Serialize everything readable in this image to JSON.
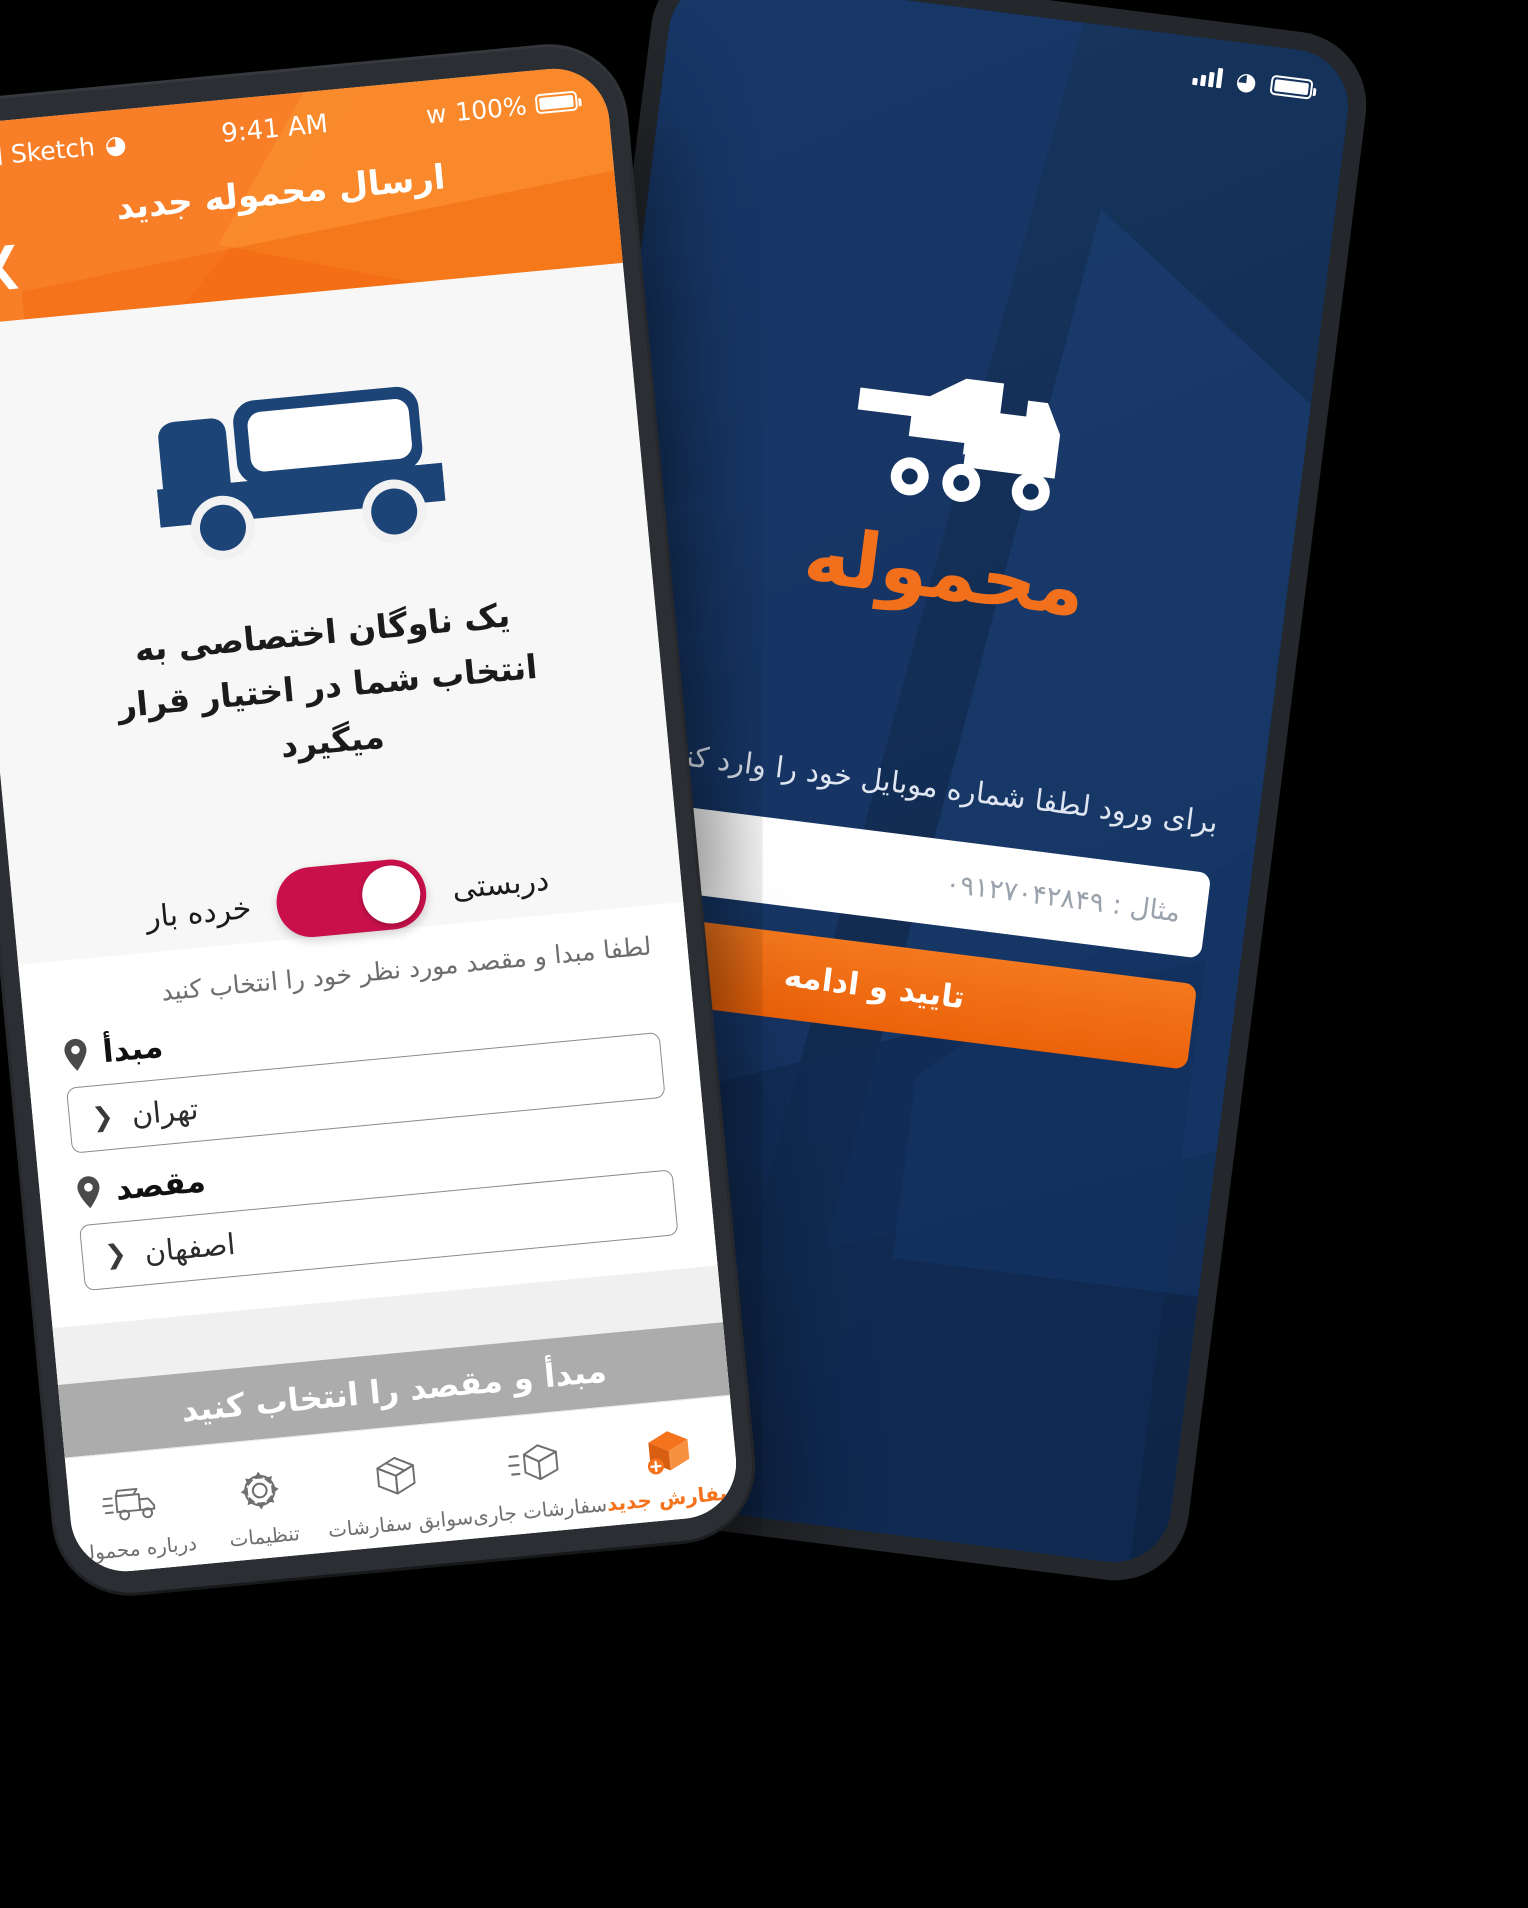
{
  "front_phone": {
    "status_bar": {
      "carrier": "Sketch",
      "signal_icon": "signal-bars-icon",
      "wifi_icon": "wifi-icon",
      "time": "9:41 AM",
      "bluetooth_icon": "bluetooth-icon",
      "battery_percent": "100%",
      "battery_icon": "battery-full-icon"
    },
    "header": {
      "title": "ارسال محموله جدید",
      "back_icon": "chevron-left-icon",
      "bg_color": "#F4731C"
    },
    "hero": {
      "truck_icon": "truck-illustration-icon",
      "truck_color": "#1C4477",
      "description": "یک ناوگان اختصاصی به انتخاب شما در اختیار قرار میگیرد"
    },
    "shipment_toggle": {
      "right_label": "دربستی",
      "left_label": "خرده بار",
      "state": "on",
      "track_color": "#C9104B",
      "knob_color": "#FFFFFF"
    },
    "route_form": {
      "hint": "لطفا مبدا و مقصد مورد نظر خود را انتخاب کنید",
      "origin": {
        "label": "مبدأ",
        "pin_icon": "map-pin-icon",
        "value": "تهران",
        "chevron_icon": "chevron-left-icon"
      },
      "destination": {
        "label": "مقصد",
        "pin_icon": "map-pin-icon",
        "value": "اصفهان",
        "chevron_icon": "chevron-left-icon"
      }
    },
    "cta": {
      "label": "مبدأ و مقصد را انتخاب کنید",
      "color": "#ACACAC",
      "enabled": "false"
    },
    "tabbar": {
      "active_color": "#F4731C",
      "items": [
        {
          "label": "سفارش جدید",
          "icon": "new-order-box-icon",
          "active": true
        },
        {
          "label": "سفارشات جاری",
          "icon": "current-orders-box-icon",
          "active": false
        },
        {
          "label": "سوابق سفارشات",
          "icon": "order-history-box-icon",
          "active": false
        },
        {
          "label": "تنظیمات",
          "icon": "gear-icon",
          "active": false
        },
        {
          "label": "درباره محموله",
          "icon": "about-truck-icon",
          "active": false
        }
      ]
    }
  },
  "back_phone": {
    "status_bar": {
      "signal_icon": "signal-bars-icon",
      "wifi_icon": "wifi-icon",
      "battery_icon": "battery-full-icon"
    },
    "brand": {
      "logo_icon": "mahmoole-truck-logo-icon",
      "wordmark": "محموله",
      "wordmark_color": "#F2701B",
      "bg_color": "#11305C"
    },
    "login": {
      "prompt": "برای ورود لطفا شماره موبایل خود را وارد کنید",
      "input_placeholder": "مثال : ۰۹۱۲۷۰۴۲۸۴۹",
      "submit_label": "تایید و ادامه",
      "submit_color": "#F4731C"
    }
  }
}
